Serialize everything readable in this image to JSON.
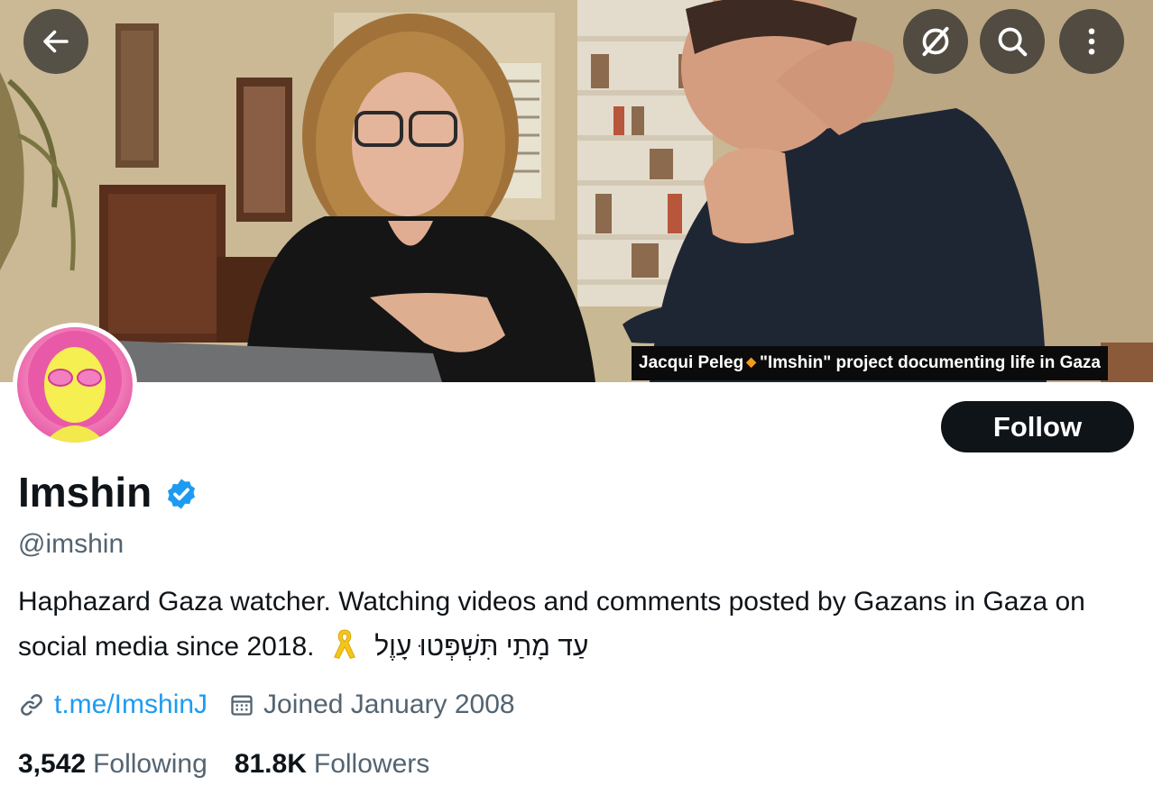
{
  "banner": {
    "caption_name": "Jacqui Peleg",
    "caption_separator": "◆",
    "caption_text": "\"Imshin\" project documenting life in Gaza"
  },
  "toolbar": {
    "back_icon": "arrow-left-icon",
    "grok_icon": "grok-icon",
    "search_icon": "search-icon",
    "more_icon": "more-vertical-icon"
  },
  "profile": {
    "display_name": "Imshin",
    "verified": true,
    "verified_color": "#1d9bf0",
    "handle": "@imshin",
    "follow_label": "Follow",
    "bio_text": "Haphazard Gaza watcher. Watching videos and comments posted by Gazans in Gaza on social media since 2018.",
    "bio_emoji": "yellow-ribbon-icon",
    "bio_hebrew": "עַד מָתַי תִּשְׁפְּטוּ עָוֶל",
    "link": "t.me/ImshinJ",
    "joined": "Joined January 2008",
    "following_count": "3,542",
    "following_label": "Following",
    "followers_count": "81.8K",
    "followers_label": "Followers"
  },
  "colors": {
    "text_primary": "#0f1419",
    "text_secondary": "#536471",
    "link": "#1d9bf0",
    "follow_button_bg": "#0f1419"
  }
}
